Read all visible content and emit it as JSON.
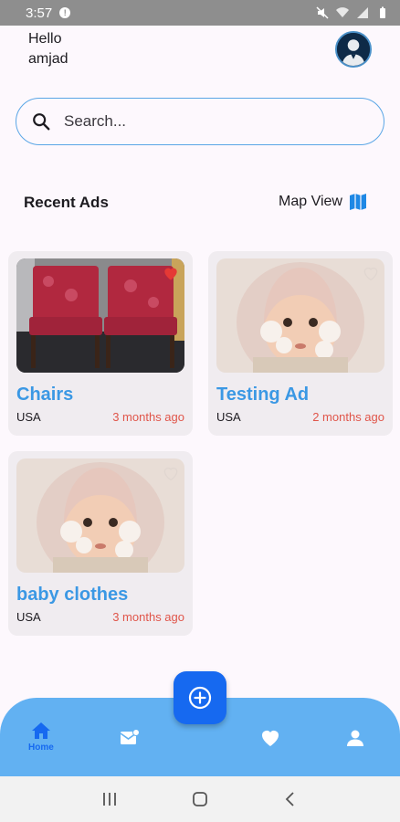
{
  "status_bar": {
    "time": "3:57"
  },
  "header": {
    "greeting": "Hello",
    "username": "amjad"
  },
  "search": {
    "placeholder": "Search..."
  },
  "section": {
    "title": "Recent Ads",
    "map_view_label": "Map View"
  },
  "ads": [
    {
      "title": "Chairs",
      "location": "USA",
      "posted": "3 months ago",
      "favorited": true,
      "image": "red-chairs"
    },
    {
      "title": "Testing Ad",
      "location": "USA",
      "posted": "2 months ago",
      "favorited": false,
      "image": "baby-photo"
    },
    {
      "title": "baby clothes",
      "location": "USA",
      "posted": "3 months ago",
      "favorited": false,
      "image": "baby-photo"
    }
  ],
  "bottom_nav": {
    "items": [
      {
        "icon": "home-icon",
        "label": "Home",
        "active": true
      },
      {
        "icon": "messages-icon"
      },
      {
        "icon": "heart-icon"
      },
      {
        "icon": "person-icon"
      }
    ]
  },
  "colors": {
    "accent": "#3b98e4",
    "nav_bg": "#62b1f2",
    "fab": "#1669f0",
    "date": "#e0554a",
    "favorite": "#e53935"
  }
}
